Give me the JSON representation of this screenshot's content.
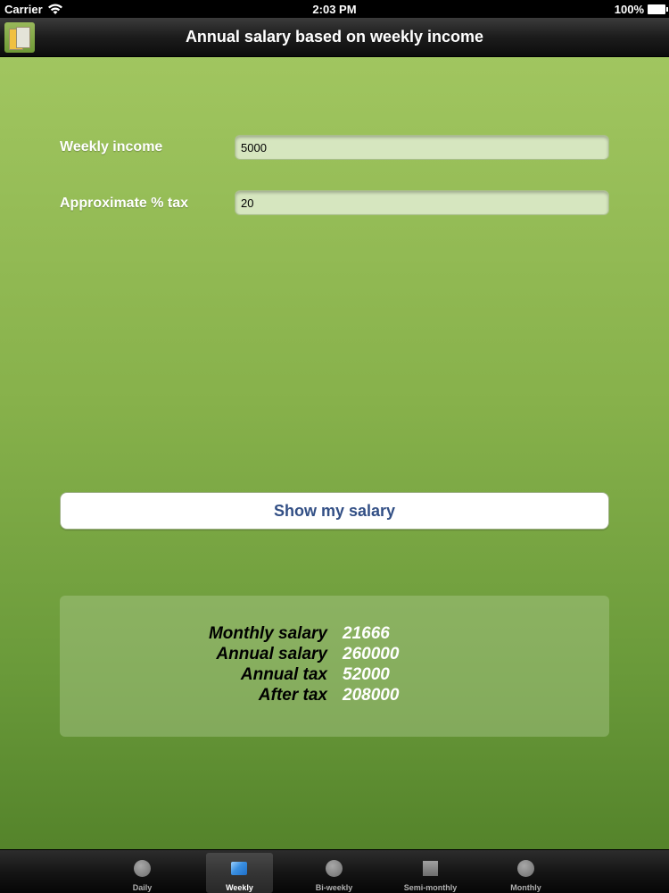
{
  "status_bar": {
    "carrier": "Carrier",
    "time": "2:03 PM",
    "battery": "100%"
  },
  "nav_bar": {
    "title": "Annual salary based on weekly income",
    "app_icon": "app-icon"
  },
  "form": {
    "weekly_income_label": "Weekly income",
    "weekly_income_value": "5000",
    "tax_label": "Approximate % tax",
    "tax_value": "20"
  },
  "actions": {
    "show_salary_label": "Show my salary"
  },
  "results": [
    {
      "label": "Monthly salary",
      "value": "21666"
    },
    {
      "label": "Annual salary",
      "value": "260000"
    },
    {
      "label": "Annual tax",
      "value": "52000"
    },
    {
      "label": "After tax",
      "value": "208000"
    }
  ],
  "tab_bar": {
    "selected": "Weekly",
    "tabs": [
      {
        "label": "Daily",
        "icon": "circle-icon"
      },
      {
        "label": "Weekly",
        "icon": "weekly-icon"
      },
      {
        "label": "Bi-weekly",
        "icon": "circle-icon"
      },
      {
        "label": "Semi-monthly",
        "icon": "square-icon"
      },
      {
        "label": "Monthly",
        "icon": "circle-icon"
      }
    ]
  },
  "colors": {
    "background_top": "#a5c963",
    "background_bottom": "#4f7e27",
    "button_text": "#324f85",
    "field_fill": "#d6e6bf"
  }
}
